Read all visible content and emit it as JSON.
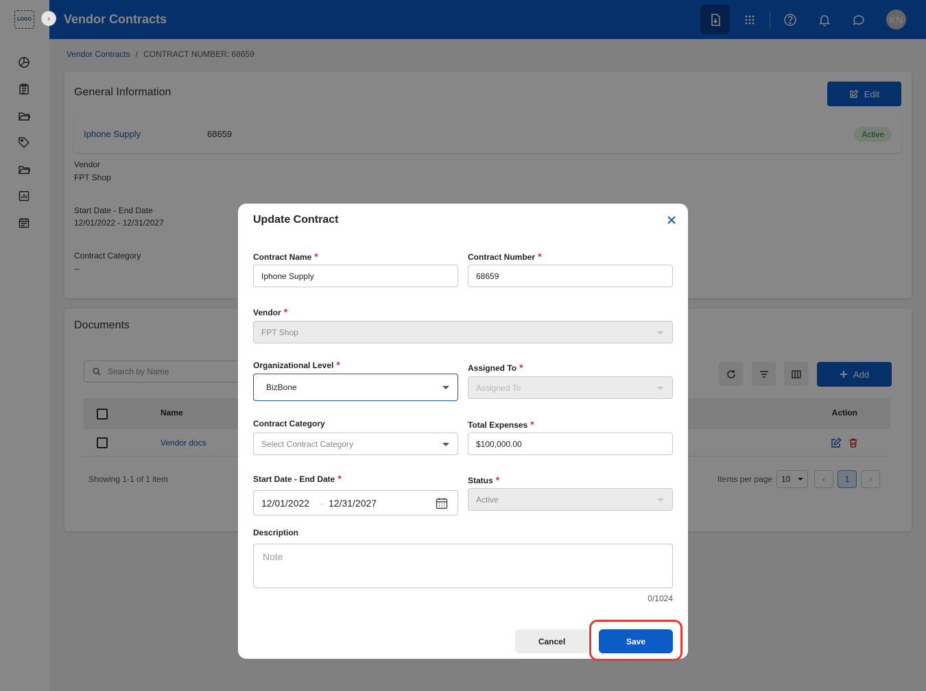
{
  "sidebar": {
    "logo": "LOGO",
    "collapse_icon": "chevron-right-icon"
  },
  "topbar": {
    "title": "Vendor Contracts",
    "avatar_initials": "KN",
    "icons": [
      "download-doc-icon",
      "apps-grid-icon",
      "help-icon",
      "bell-icon",
      "chat-icon"
    ]
  },
  "breadcrumb": {
    "parent": "Vendor Contracts",
    "separator": "/",
    "current": "CONTRACT NUMBER: 68659"
  },
  "general": {
    "title": "General Information",
    "edit_label": "Edit",
    "contract_name": "Iphone Supply",
    "contract_number": "68659",
    "status": "Active",
    "vendor_label": "Vendor",
    "vendor_value": "FPT Shop",
    "dates_label": "Start Date - End Date",
    "dates_value": "12/01/2022 - 12/31/2027",
    "category_label": "Contract Category",
    "category_value": "--"
  },
  "documents": {
    "title": "Documents",
    "search_placeholder": "Search by Name",
    "add_label": "Add",
    "col_name": "Name",
    "col_action": "Action",
    "rows": [
      {
        "name": "Vendor docs"
      }
    ],
    "showing": "Showing 1-1 of 1 item",
    "items_per_page_label": "Items per page",
    "items_per_page": "10",
    "current_page": "1"
  },
  "modal": {
    "title": "Update Contract",
    "contract_name_label": "Contract Name",
    "contract_name_value": "Iphone Supply",
    "contract_number_label": "Contract Number",
    "contract_number_value": "68659",
    "vendor_label": "Vendor",
    "vendor_value": "FPT Shop",
    "org_level_label": "Organizational Level",
    "org_level_value": "BizBone",
    "assigned_label": "Assigned To",
    "assigned_placeholder": "Assigned To",
    "category_label": "Contract Category",
    "category_placeholder": "Select Contract Category",
    "expenses_label": "Total Expenses",
    "expenses_value": "$100,000.00",
    "dates_label": "Start Date - End Date",
    "start_date": "12/01/2022",
    "date_sep": "-",
    "end_date": "12/31/2027",
    "status_label": "Status",
    "status_value": "Active",
    "description_label": "Description",
    "description_placeholder": "Note",
    "char_counter": "0/1024",
    "cancel_label": "Cancel",
    "save_label": "Save",
    "required_mark": "*"
  },
  "colors": {
    "primary": "#0d5bc6",
    "link": "#1a56b0",
    "required": "#d32f2f",
    "highlight": "#e53935"
  }
}
